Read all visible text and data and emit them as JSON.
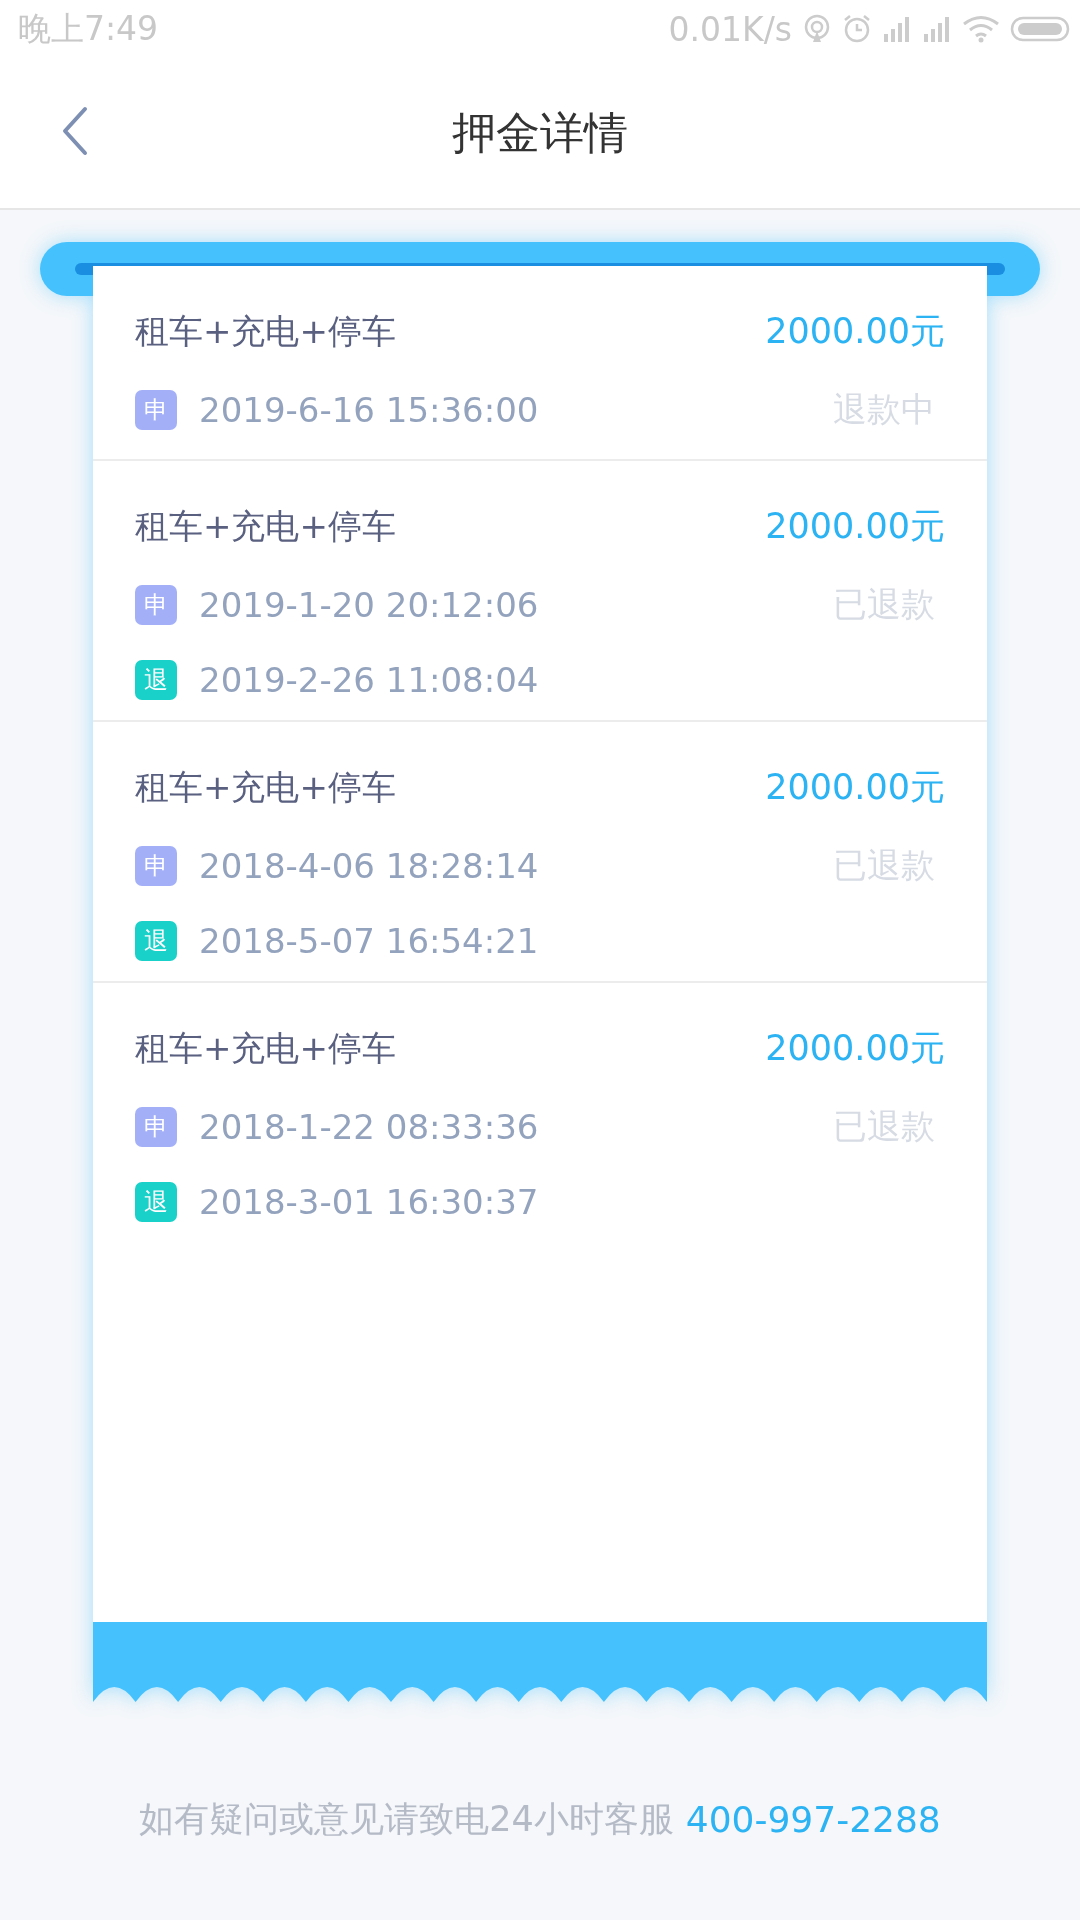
{
  "status_bar": {
    "time": "晚上7:49",
    "speed": "0.01K/s"
  },
  "header": {
    "title": "押金详情"
  },
  "deposits": [
    {
      "title": "租车+充电+停车",
      "amount": "2000.00元",
      "status": "退款中",
      "records": [
        {
          "kind": "apply",
          "tag": "申",
          "time": "2019-6-16 15:36:00"
        }
      ]
    },
    {
      "title": "租车+充电+停车",
      "amount": "2000.00元",
      "status": "已退款",
      "records": [
        {
          "kind": "apply",
          "tag": "申",
          "time": "2019-1-20 20:12:06"
        },
        {
          "kind": "refund",
          "tag": "退",
          "time": "2019-2-26 11:08:04"
        }
      ]
    },
    {
      "title": "租车+充电+停车",
      "amount": "2000.00元",
      "status": "已退款",
      "records": [
        {
          "kind": "apply",
          "tag": "申",
          "time": "2018-4-06 18:28:14"
        },
        {
          "kind": "refund",
          "tag": "退",
          "time": "2018-5-07 16:54:21"
        }
      ]
    },
    {
      "title": "租车+充电+停车",
      "amount": "2000.00元",
      "status": "已退款",
      "records": [
        {
          "kind": "apply",
          "tag": "申",
          "time": "2018-1-22 08:33:36"
        },
        {
          "kind": "refund",
          "tag": "退",
          "time": "2018-3-01 16:30:37"
        }
      ]
    }
  ],
  "footer": {
    "note": "如有疑问或意见请致电24小时客服",
    "phone": "400-997-2288"
  }
}
